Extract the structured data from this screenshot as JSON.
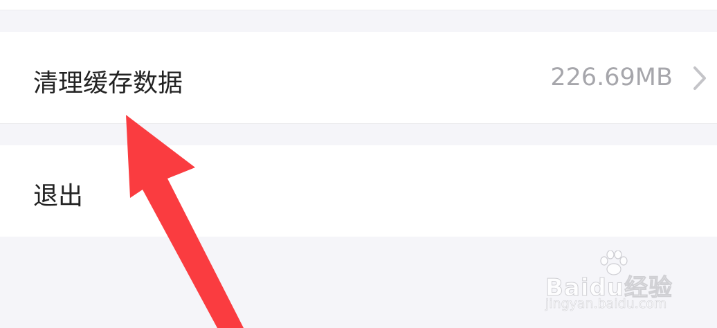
{
  "settings": {
    "items": [
      {
        "label": "清理缓存数据",
        "value": "226.69MB",
        "icon": "chevron-right-icon"
      },
      {
        "label": "退出"
      }
    ]
  },
  "annotation": {
    "arrow_color": "#fa3c40"
  },
  "watermark": {
    "brand": "Baidu经验",
    "url": "jingyan.baidu.com",
    "icon": "baidu-paw-icon"
  }
}
